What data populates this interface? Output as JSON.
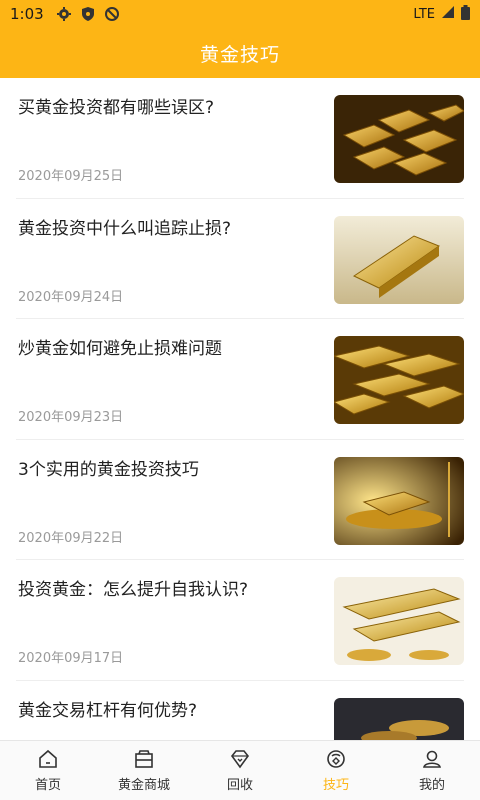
{
  "status_bar": {
    "time": "1:03",
    "network": "LTE",
    "icons": [
      "gear-icon",
      "shield-icon",
      "no-disturb-icon",
      "signal-icon",
      "battery-icon"
    ]
  },
  "header": {
    "title": "黄金技巧"
  },
  "colors": {
    "accent": "#FDB515",
    "text": "#222222",
    "subtext": "#9a9a9a"
  },
  "articles": [
    {
      "title": "买黄金投资都有哪些误区?",
      "date": "2020年09月25日",
      "thumb": "gold-bars-pile-image"
    },
    {
      "title": "黄金投资中什么叫追踪止损?",
      "date": "2020年09月24日",
      "thumb": "single-gold-bar-image"
    },
    {
      "title": "炒黄金如何避免止损难问题",
      "date": "2020年09月23日",
      "thumb": "gold-bars-stack-image"
    },
    {
      "title": "3个实用的黄金投资技巧",
      "date": "2020年09月22日",
      "thumb": "gold-bars-scale-image"
    },
    {
      "title": "投资黄金：怎么提升自我认识?",
      "date": "2020年09月17日",
      "thumb": "gold-bars-treasure-image"
    },
    {
      "title": "黄金交易杠杆有何优势?",
      "date": "",
      "thumb": "gold-bars-dark-image"
    }
  ],
  "tabs": [
    {
      "label": "首页",
      "icon": "home-icon",
      "active": false
    },
    {
      "label": "黄金商城",
      "icon": "shop-icon",
      "active": false
    },
    {
      "label": "回收",
      "icon": "diamond-icon",
      "active": false
    },
    {
      "label": "技巧",
      "icon": "tips-icon",
      "active": true
    },
    {
      "label": "我的",
      "icon": "user-icon",
      "active": false
    }
  ]
}
